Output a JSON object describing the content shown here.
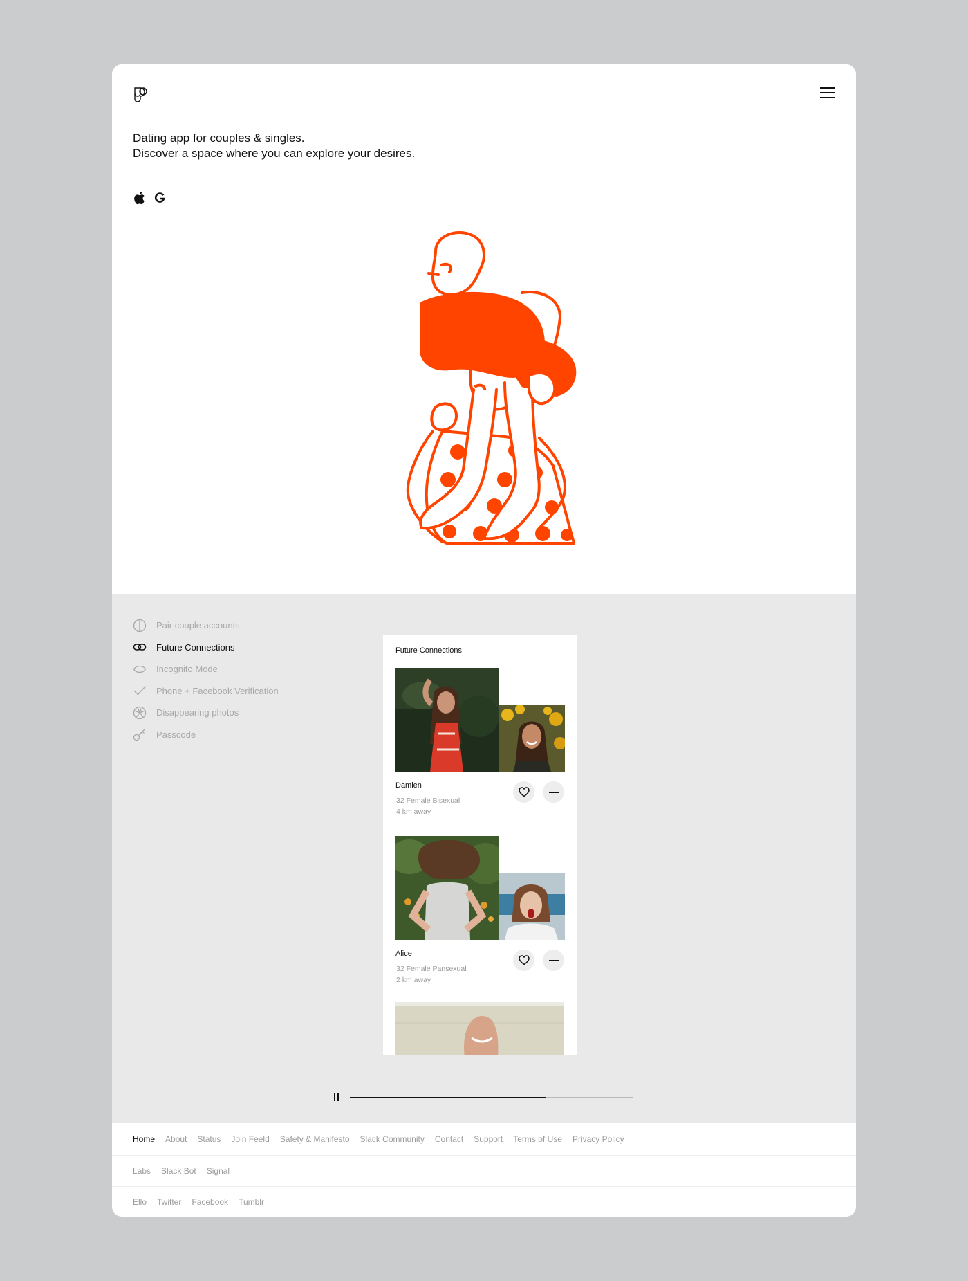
{
  "header": {
    "tagline_line1": "Dating app for couples & singles.",
    "tagline_line2": "Discover a space where you can explore your desires.",
    "brand_color": "#ff4400",
    "icons": [
      "logo-icon",
      "menu-icon",
      "apple-icon",
      "google-icon"
    ]
  },
  "features": {
    "items": [
      {
        "label": "Pair couple accounts",
        "icon": "half-circle-icon",
        "active": false
      },
      {
        "label": "Future Connections",
        "icon": "link-icon",
        "active": true
      },
      {
        "label": "Incognito Mode",
        "icon": "eye-icon",
        "active": false
      },
      {
        "label": "Phone + Facebook Verification",
        "icon": "checkmark-icon",
        "active": false
      },
      {
        "label": "Disappearing photos",
        "icon": "aperture-icon",
        "active": false
      },
      {
        "label": "Passcode",
        "icon": "key-icon",
        "active": false
      }
    ]
  },
  "phone": {
    "title": "Future Connections",
    "profiles": [
      {
        "name": "Damien",
        "details": "32 Female Bisexual",
        "distance": "4 km away"
      },
      {
        "name": "Alice",
        "details": "32 Female Pansexual",
        "distance": "2 km away"
      }
    ]
  },
  "player": {
    "progress": 0.69
  },
  "footer": {
    "row1": [
      "Home",
      "About",
      "Status",
      "Join Feeld",
      "Safety & Manifesto",
      "Slack Community",
      "Contact",
      "Support",
      "Terms of Use",
      "Privacy Policy"
    ],
    "row2": [
      "Labs",
      "Slack Bot",
      "Signal"
    ],
    "row3": [
      "Ello",
      "Twitter",
      "Facebook",
      "Tumblr"
    ]
  }
}
